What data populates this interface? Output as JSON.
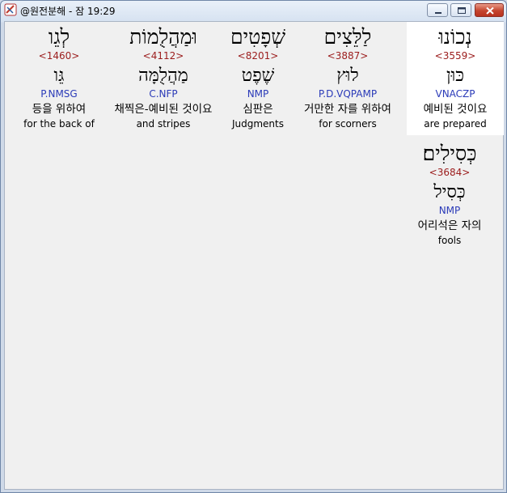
{
  "window": {
    "title": "@원전분해 - 잠 19:29"
  },
  "colors": {
    "strong": "#9b1c1c",
    "parse": "#2a3ab8",
    "selected_background": "#ffffff"
  },
  "words": [
    {
      "hebrew": "נְכוֹנוּ",
      "strong": "<3559>",
      "root": "כּוּן",
      "parse": "VNACZP",
      "korean": "예비된 것이요",
      "english": "are prepared",
      "selected": true
    },
    {
      "hebrew": "לַלֵּצִים",
      "strong": "<3887>",
      "root": "לוּץ",
      "parse": "P.D.VQPAMP",
      "korean": "거만한 자를 위하여",
      "english": "for scorners"
    },
    {
      "hebrew": "שְׁפָטִים",
      "strong": "<8201>",
      "root": "שֶׁפֶט",
      "parse": "NMP",
      "korean": "심판은",
      "english": "Judgments"
    },
    {
      "hebrew": "וּמַהֲלֻמוֹת",
      "strong": "<4112>",
      "root": "מַהֲלֻמָּה",
      "parse": "C.NFP",
      "korean": "채찍은-예비된 것이요",
      "english": "and stripes"
    },
    {
      "hebrew": "לְגֵו",
      "strong": "<1460>",
      "root": "גֵּו",
      "parse": "P.NMSG",
      "korean": "등을 위하여",
      "english": "for the back of"
    },
    {
      "hebrew": "כְּסִילִים׃",
      "strong": "<3684>",
      "root": "כְּסִיל",
      "parse": "NMP",
      "korean": "어리석은 자의",
      "english": "fools"
    }
  ]
}
